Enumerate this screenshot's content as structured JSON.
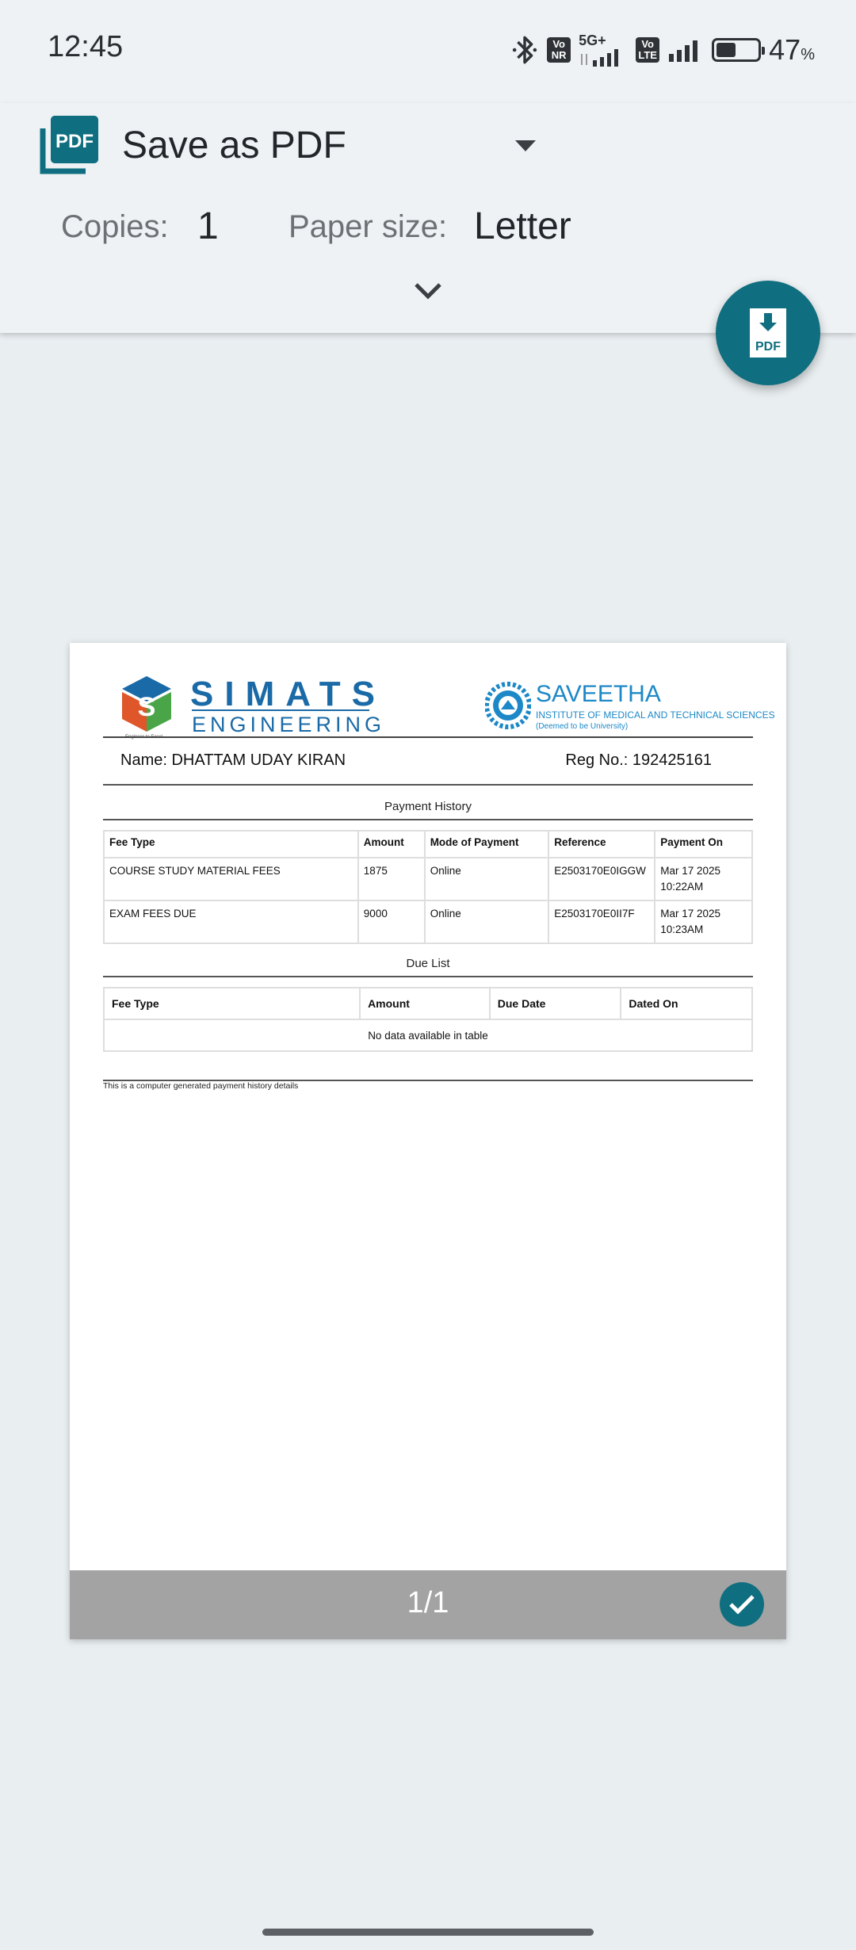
{
  "status_bar": {
    "time": "12:45",
    "network_badge_1": "Vo NR",
    "network_type": "5G+",
    "network_badge_2": "Vo LTE",
    "battery_percent": "47",
    "battery_unit": "%",
    "battery_level": 0.47
  },
  "print_header": {
    "destination": "Save as PDF",
    "copies_label": "Copies:",
    "copies_value": "1",
    "paper_size_label": "Paper size:",
    "paper_size_value": "Letter",
    "app_icon_text": "PDF",
    "fab_icon_text": "PDF"
  },
  "document": {
    "logo_left_word": "SIMATS",
    "logo_left_sub": "ENGINEERING",
    "logo_left_tagline": "Engineer to Excel",
    "logo_right_word": "SAVEETHA",
    "logo_right_sub": "INSTITUTE OF MEDICAL AND TECHNICAL SCIENCES",
    "logo_right_sub2": "(Deemed to be University)",
    "name_line": "Name: DHATTAM UDAY KIRAN",
    "reg_line": "Reg No.: 192425161",
    "payment_history_title": "Payment History",
    "payment_table": {
      "headers": [
        "Fee Type",
        "Amount",
        "Mode of Payment",
        "Reference",
        "Payment On"
      ],
      "rows": [
        [
          "COURSE STUDY MATERIAL FEES",
          "1875",
          "Online",
          "E2503170E0IGGW",
          "Mar 17 2025 10:22AM"
        ],
        [
          "EXAM FEES DUE",
          "9000",
          "Online",
          "E2503170E0II7F",
          "Mar 17 2025 10:23AM"
        ]
      ]
    },
    "due_list_title": "Due List",
    "due_table": {
      "headers": [
        "Fee Type",
        "Amount",
        "Due Date",
        "Dated On"
      ],
      "empty_message": "No data available in table"
    },
    "footer_note": "This is a computer generated payment history details"
  },
  "page_bar": {
    "page_counter": "1/1"
  }
}
